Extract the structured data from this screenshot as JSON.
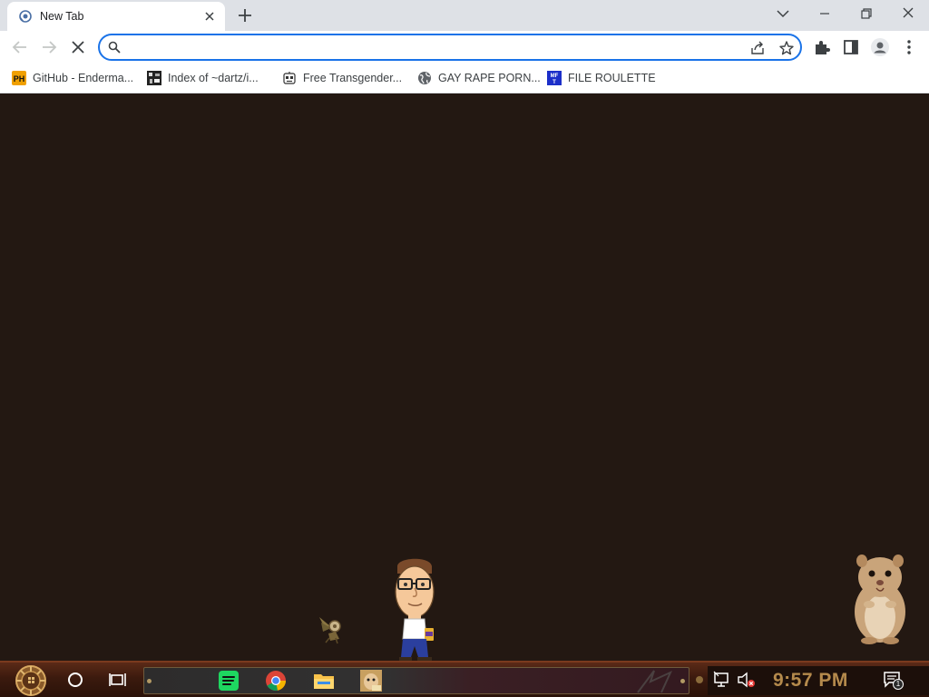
{
  "window": {
    "tab_title": "New Tab",
    "buttons": [
      "new-tab",
      "tab-search",
      "minimize",
      "restore",
      "close"
    ]
  },
  "toolbar": {
    "address_value": "",
    "address_placeholder": "",
    "loading": true
  },
  "bookmarks": [
    {
      "label": "GitHub - Enderma...",
      "icon": "ph-logo-icon"
    },
    {
      "label": "Index of ~dartz/i...",
      "icon": "pixel-site-icon"
    },
    {
      "label": "Free Transgender...",
      "icon": "robot-face-icon"
    },
    {
      "label": "GAY RAPE PORN...",
      "icon": "globe-icon"
    },
    {
      "label": "FILE ROULETTE",
      "icon": "mft-logo-icon"
    }
  ],
  "taskbar": {
    "clock": "9:57 PM",
    "notification_count": "1",
    "pinned": [
      "spotify-icon",
      "chrome-icon",
      "file-explorer-icon",
      "hamster-app-icon"
    ]
  },
  "colors": {
    "page_background": "#231812",
    "accent": "#1a73e8",
    "clock": "#b58a4c"
  }
}
